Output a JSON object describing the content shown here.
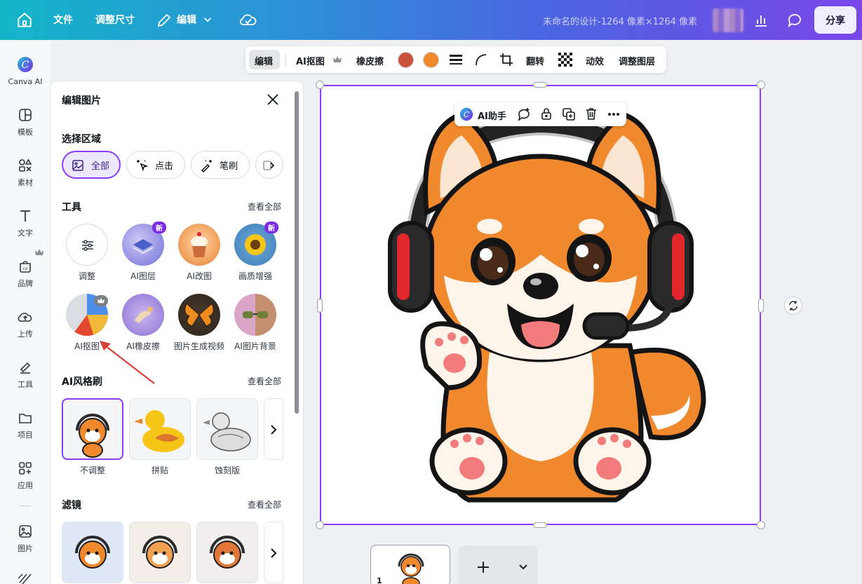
{
  "topbar": {
    "menu": [
      "文件",
      "调整尺寸",
      "编辑"
    ],
    "design_title": "未命名的设计-1264 像素×1264 像素",
    "share_label": "分享"
  },
  "rail": {
    "items": [
      "Canva AI",
      "模板",
      "素材",
      "文字",
      "品牌",
      "上传",
      "工具",
      "项目",
      "应用",
      "图片"
    ]
  },
  "panel": {
    "title": "编辑图片",
    "select_area": {
      "heading": "选择区域",
      "chips": [
        "全部",
        "点击",
        "笔刷"
      ]
    },
    "tools": {
      "heading": "工具",
      "see_all": "查看全部",
      "new_badge": "新",
      "items": [
        "调整",
        "AI图层",
        "AI改图",
        "画质增强",
        "AI抠图",
        "AI橡皮擦",
        "图片生成视频",
        "AI图片背景"
      ]
    },
    "style_brush": {
      "heading": "AI风格刷",
      "see_all": "查看全部",
      "items": [
        "不调整",
        "拼贴",
        "蚀刻版"
      ]
    },
    "filters": {
      "heading": "滤镜",
      "see_all": "查看全部"
    }
  },
  "edit_toolbar": {
    "items": [
      "编辑",
      "AI抠图",
      "橡皮擦",
      "翻转",
      "动效",
      "调整图层"
    ],
    "swatches": [
      "#c9533a",
      "#f0892e"
    ]
  },
  "ai_toolbar": {
    "label": "AI助手"
  },
  "pages": {
    "current": "1"
  },
  "colors": {
    "accent": "#8b3dff",
    "orange": "#f0892e"
  }
}
